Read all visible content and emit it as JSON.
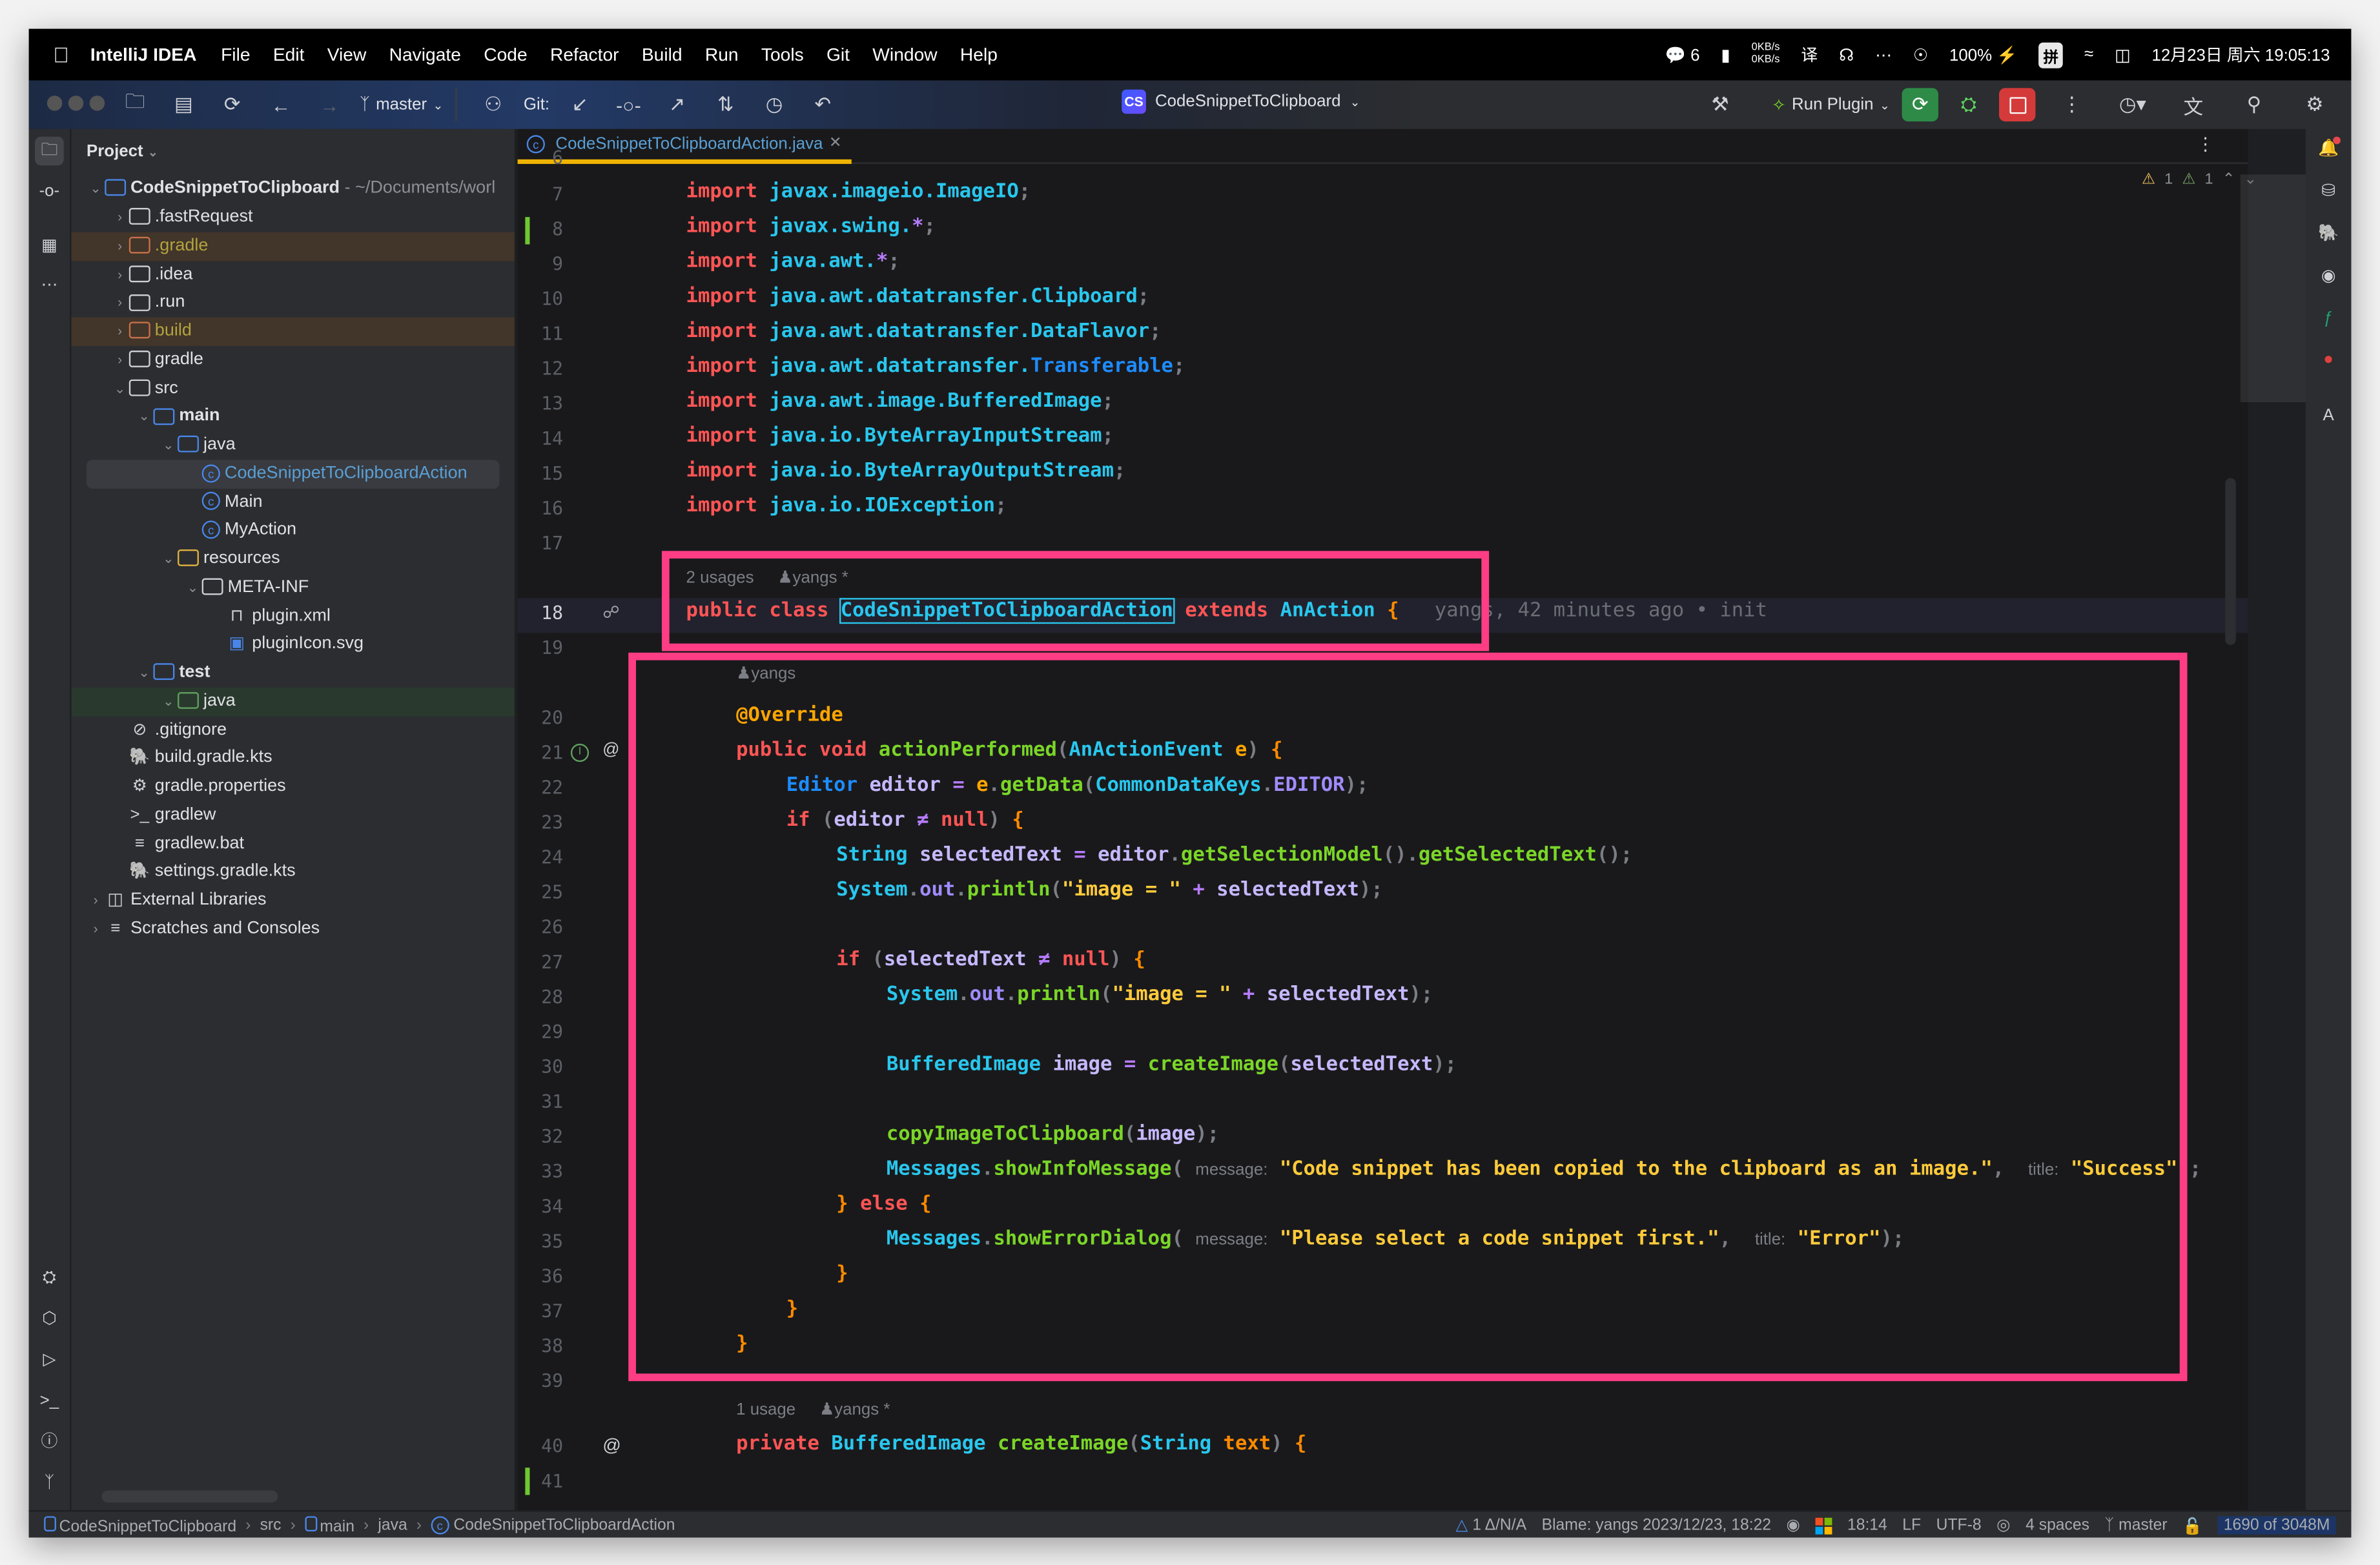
{
  "menubar": {
    "app_name": "IntelliJ IDEA",
    "items": [
      "File",
      "Edit",
      "View",
      "Navigate",
      "Code",
      "Refactor",
      "Build",
      "Run",
      "Tools",
      "Git",
      "Window",
      "Help"
    ],
    "wechat_count": "6",
    "net_up": "0KB/s",
    "net_down": "0KB/s",
    "battery": "100%",
    "input_method": "拼",
    "datetime": "12月23日 周六 19:05:13"
  },
  "toolbar": {
    "branch": "master",
    "git_label": "Git:",
    "project_badge": "CS",
    "project_name": "CodeSnippetToClipboard",
    "run_config": "Run Plugin",
    "colors": {
      "rerun": "#2e8b47",
      "stop": "#d43a3a"
    }
  },
  "project": {
    "header": "Project",
    "root_name": "CodeSnippetToClipboard",
    "root_path": "- ~/Documents/worl",
    "tree": [
      {
        "label": ".fastRequest",
        "kind": "folder"
      },
      {
        "label": ".gradle",
        "kind": "excluded"
      },
      {
        "label": ".idea",
        "kind": "folder"
      },
      {
        "label": ".run",
        "kind": "folder"
      },
      {
        "label": "build",
        "kind": "excluded"
      },
      {
        "label": "gradle",
        "kind": "folder"
      },
      {
        "label": "src",
        "kind": "folder"
      },
      {
        "label": "main",
        "kind": "module"
      },
      {
        "label": "java",
        "kind": "source"
      },
      {
        "label": "CodeSnippetToClipboardAction",
        "kind": "class",
        "selected": true
      },
      {
        "label": "Main",
        "kind": "class"
      },
      {
        "label": "MyAction",
        "kind": "class"
      },
      {
        "label": "resources",
        "kind": "resources"
      },
      {
        "label": "META-INF",
        "kind": "folder"
      },
      {
        "label": "plugin.xml",
        "kind": "plugin"
      },
      {
        "label": "pluginIcon.svg",
        "kind": "image"
      },
      {
        "label": "test",
        "kind": "module"
      },
      {
        "label": "java",
        "kind": "testsource"
      },
      {
        "label": ".gitignore",
        "kind": "ignore"
      },
      {
        "label": "build.gradle.kts",
        "kind": "gradle"
      },
      {
        "label": "gradle.properties",
        "kind": "settings"
      },
      {
        "label": "gradlew",
        "kind": "shell"
      },
      {
        "label": "gradlew.bat",
        "kind": "text"
      },
      {
        "label": "settings.gradle.kts",
        "kind": "gradle"
      },
      {
        "label": "External Libraries",
        "kind": "libs"
      },
      {
        "label": "Scratches and Consoles",
        "kind": "scratches"
      }
    ]
  },
  "editor": {
    "tab_label": "CodeSnippetToClipboardAction.java",
    "inspections": {
      "warnings": "1",
      "weak_warnings": "1"
    },
    "lines": {
      "l6": "6",
      "l7": "7",
      "l8": "8",
      "l9": "9",
      "l10": "10",
      "l11": "11",
      "l12": "12",
      "l13": "13",
      "l14": "14",
      "l15": "15",
      "l16": "16",
      "l17": "17",
      "l18": "18",
      "l19": "19",
      "l20": "20",
      "l21": "21",
      "l22": "22",
      "l23": "23",
      "l24": "24",
      "l25": "25",
      "l26": "26",
      "l27": "27",
      "l28": "28",
      "l29": "29",
      "l30": "30",
      "l31": "31",
      "l32": "32",
      "l33": "33",
      "l34": "34",
      "l35": "35",
      "l36": "36",
      "l37": "37",
      "l38": "38",
      "l39": "39",
      "l40": "40",
      "l41": "41"
    },
    "imports": [
      {
        "pkg": "javax.imageio.",
        "name": "ImageIO"
      },
      {
        "pkg": "javax.swing.",
        "name": "*"
      },
      {
        "pkg": "java.awt.",
        "name": "*"
      },
      {
        "pkg": "java.awt.datatransfer.",
        "name": "Clipboard"
      },
      {
        "pkg": "java.awt.datatransfer.",
        "name": "DataFlavor"
      },
      {
        "pkg": "java.awt.datatransfer.",
        "name": "Transferable"
      },
      {
        "pkg": "java.awt.image.",
        "name": "BufferedImage"
      },
      {
        "pkg": "java.io.",
        "name": "ByteArrayInputStream"
      },
      {
        "pkg": "java.io.",
        "name": "ByteArrayOutputStream"
      },
      {
        "pkg": "java.io.",
        "name": "IOException"
      }
    ],
    "import_kw": "import",
    "class_hint": "2 usages",
    "class_hint_author": "yangs *",
    "class_decl": {
      "mods": "public class",
      "name": "CodeSnippetToClipboardAction",
      "extends": "extends",
      "parent": "AnAction",
      "brace": "{"
    },
    "blame_inline": "yangs, 42 minutes ago • init",
    "method_hint_author": "yangs",
    "annotation": "@Override",
    "method_decl": {
      "mods": "public void",
      "name": "actionPerformed",
      "ptype": "AnActionEvent",
      "pname": "e"
    },
    "code": {
      "l22": {
        "type": "Editor",
        "var": "editor",
        "obj": "e",
        "call": "getData",
        "cls": "CommonDataKeys",
        "field": "EDITOR"
      },
      "l23": {
        "kw": "if",
        "var": "editor",
        "null": "null"
      },
      "l24": {
        "type": "String",
        "var": "selectedText",
        "obj": "editor",
        "call1": "getSelectionModel",
        "call2": "getSelectedText"
      },
      "l25": {
        "cls": "System",
        "field": "out",
        "call": "println",
        "str": "\"image = \"",
        "var": "selectedText"
      },
      "l27": {
        "kw": "if",
        "var": "selectedText",
        "null": "null"
      },
      "l28": {
        "cls": "System",
        "field": "out",
        "call": "println",
        "str": "\"image = \"",
        "var": "selectedText"
      },
      "l30": {
        "type": "BufferedImage",
        "var": "image",
        "call": "createImage",
        "arg": "selectedText"
      },
      "l32": {
        "call": "copyImageToClipboard",
        "arg": "image"
      },
      "l33": {
        "cls": "Messages",
        "call": "showInfoMessage",
        "hint1": "message:",
        "str1": "\"Code snippet has been copied to the clipboard as an image.\"",
        "hint2": "title:",
        "str2": "\"Success\""
      },
      "l34": {
        "kw": "else"
      },
      "l35": {
        "cls": "Messages",
        "call": "showErrorDialog",
        "hint1": "message:",
        "str1": "\"Please select a code snippet first.\"",
        "hint2": "title:",
        "str2": "\"Error\""
      }
    },
    "create_hint": "1 usage",
    "create_hint_author": "yangs *",
    "create_decl": {
      "kw": "private",
      "type": "BufferedImage",
      "name": "createImage",
      "ptype": "String",
      "pname": "text"
    },
    "highlight_color": "#ff3d85"
  },
  "statusbar": {
    "breadcrumbs": [
      "CodeSnippetToClipboard",
      "src",
      "main",
      "java",
      "CodeSnippetToClipboardAction"
    ],
    "vcs_status": "1 Δ/N/A",
    "blame": "Blame: yangs 2023/12/23, 18:22",
    "position": "18:14",
    "line_sep": "LF",
    "encoding": "UTF-8",
    "indent": "4 spaces",
    "branch": "master",
    "memory": "1690 of 3048M"
  }
}
